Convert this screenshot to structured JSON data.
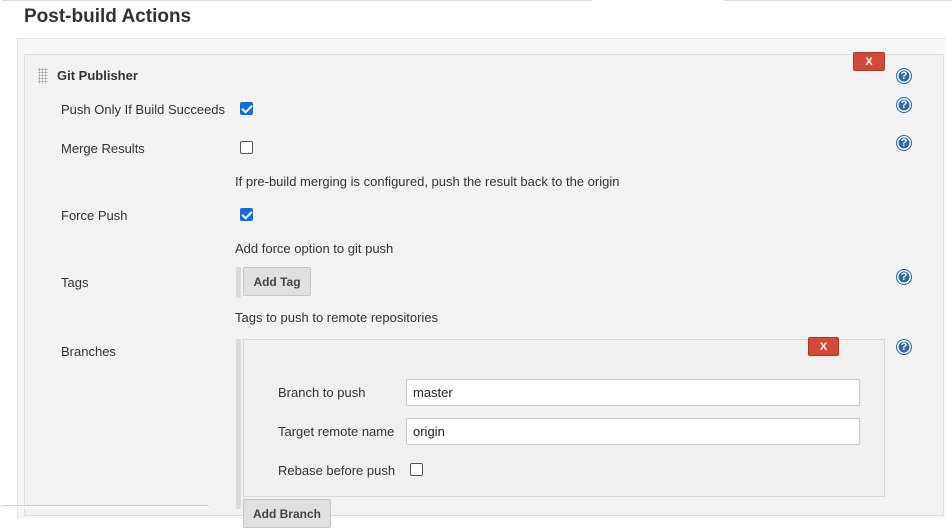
{
  "section": {
    "title": "Post-build Actions"
  },
  "publisher": {
    "title": "Git Publisher",
    "delete_label": "X",
    "help_glyph": "?"
  },
  "fields": {
    "push_only": {
      "label": "Push Only If Build Succeeds",
      "checked": true
    },
    "merge_results": {
      "label": "Merge Results",
      "checked": false,
      "description": "If pre-build merging is configured, push the result back to the origin"
    },
    "force_push": {
      "label": "Force Push",
      "checked": true,
      "description": "Add force option to git push"
    },
    "tags": {
      "label": "Tags",
      "button_label": "Add Tag",
      "description": "Tags to push to remote repositories"
    },
    "branches": {
      "label": "Branches",
      "delete_label": "X",
      "branch_to_push_label": "Branch to push",
      "branch_to_push_value": "master",
      "target_remote_label": "Target remote name",
      "target_remote_value": "origin",
      "rebase_label": "Rebase before push",
      "rebase_checked": false,
      "add_button_label": "Add Branch"
    }
  },
  "colors": {
    "delete_button": "#d24939",
    "checkbox_checked": "#0b6ce4",
    "help_icon": "#2e6aa6"
  },
  "icons": [
    "drag-handle-icon",
    "help-icon",
    "checkmark-icon"
  ]
}
